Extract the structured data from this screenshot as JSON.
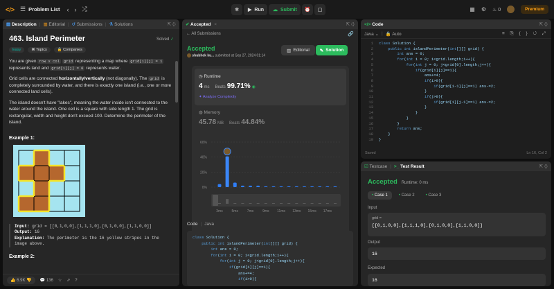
{
  "topbar": {
    "problem_list": "Problem List",
    "run": "Run",
    "submit": "Submit",
    "streak": "0",
    "premium": "Premium"
  },
  "desc_panel": {
    "tabs": [
      "Description",
      "Editorial",
      "Submissions",
      "Solutions"
    ],
    "title": "463. Island Perimeter",
    "solved": "Solved",
    "difficulty": "Easy",
    "topics": "Topics",
    "companies": "Companies",
    "p1_a": "You are given ",
    "p1_code1": "row x col",
    "p1_b": " ",
    "p1_code2": "grid",
    "p1_c": " representing a map where ",
    "p1_code3": "grid[i][j] = 1",
    "p1_d": " represents land and ",
    "p1_code4": "grid[i][j] = 0",
    "p1_e": " represents water.",
    "p2_a": "Grid cells are connected ",
    "p2_b": "horizontally/vertically",
    "p2_c": " (not diagonally). The ",
    "p2_code": "grid",
    "p2_d": " is completely surrounded by water, and there is exactly one island (i.e., one or more connected land cells).",
    "p3": "The island doesn't have \"lakes\", meaning the water inside isn't connected to the water around the island. One cell is a square with side length 1. The grid is rectangular, width and height don't exceed 100. Determine the perimeter of the island.",
    "example1": "Example 1:",
    "input_label": "Input:",
    "input_val": " grid = [[0,1,0,0],[1,1,1,0],[0,1,0,0],[1,1,0,0]]",
    "output_label": "Output:",
    "output_val": " 16",
    "expl_label": "Explanation:",
    "expl_val": " The perimeter is the 16 yellow stripes in the image above.",
    "example2": "Example 2:",
    "likes": "6.9K",
    "comments": "136",
    "grid": [
      [
        0,
        1,
        0,
        0
      ],
      [
        1,
        1,
        1,
        0
      ],
      [
        0,
        1,
        0,
        0
      ],
      [
        1,
        1,
        0,
        0
      ]
    ]
  },
  "sub_panel": {
    "tab": "Accepted",
    "all_subs": "All Submissions",
    "status": "Accepted",
    "user": "shubhek ku...",
    "submitted": "submitted at Sep 27, 2024 01:14",
    "editorial": "Editorial",
    "solution": "Solution",
    "runtime_label": "Runtime",
    "runtime_val": "4",
    "runtime_unit": "ms",
    "beats_label": "Beats",
    "beats_val": "99.71%",
    "analyze": "Analyze Complexity",
    "memory_label": "Memory",
    "memory_val": "45.78",
    "memory_unit": "MB",
    "mem_beats_label": "Beats",
    "mem_beats_val": "44.84%",
    "code_label": "Code",
    "lang": "Java"
  },
  "chart_data": {
    "type": "bar",
    "title": "",
    "ylabel": "",
    "yticks": [
      "60%",
      "40%",
      "20%",
      "0%"
    ],
    "ylim": [
      0,
      60
    ],
    "xticks": [
      "3ms",
      "5ms",
      "7ms",
      "9ms",
      "11ms",
      "13ms",
      "15ms",
      "17ms"
    ],
    "bars": [
      {
        "x": 3,
        "y": 4
      },
      {
        "x": 4,
        "y": 41
      },
      {
        "x": 5,
        "y": 6
      },
      {
        "x": 6,
        "y": 2
      },
      {
        "x": 7,
        "y": 2
      },
      {
        "x": 8,
        "y": 2
      },
      {
        "x": 9,
        "y": 1
      },
      {
        "x": 10,
        "y": 1
      },
      {
        "x": 11,
        "y": 1
      },
      {
        "x": 12,
        "y": 1
      },
      {
        "x": 13,
        "y": 1
      },
      {
        "x": 14,
        "y": 1
      },
      {
        "x": 15,
        "y": 1
      },
      {
        "x": 16,
        "y": 1
      },
      {
        "x": 17,
        "y": 1
      },
      {
        "x": 18,
        "y": 1
      }
    ],
    "highlight_x": 4,
    "mini_labels": [
      "3ms",
      "5ms",
      "7ms",
      "9ms",
      "11ms",
      "13ms",
      "15ms",
      "17ms"
    ]
  },
  "code_panel": {
    "title": "Code",
    "lang": "Java",
    "auto": "Auto",
    "saved": "Saved",
    "cursor": "Ln 16, Col 2",
    "lines": [
      "class Solution {",
      "    public int islandPerimeter(int[][] grid) {",
      "        int ans = 0;",
      "        for(int i = 0; i<grid.length;i++){",
      "            for(int j = 0; j<grid[0].length;j++){",
      "                if(grid[i][j]==1){",
      "                    ans+=4;",
      "                    if(i>0){",
      "                        if(grid[i-1][j]==1) ans-=2;",
      "                    }",
      "                    if(j>0){",
      "                        if(grid[i][j-1]==1) ans-=2;",
      "                    }",
      "                }",
      "            }",
      "        }",
      "        return ans;",
      "    }",
      "}"
    ]
  },
  "sub_code_lines": [
    "class Solution {",
    "    public int islandPerimeter(int[][] grid) {",
    "        int ans = 0;",
    "        for(int i = 0; i<grid.length;i++){",
    "            for(int j = 0; j<grid[0].length;j++){",
    "                if(grid[i][j]==1){",
    "                    ans+=4;",
    "                    if(i>0){"
  ],
  "test_panel": {
    "tab_testcase": "Testcase",
    "tab_result": "Test Result",
    "status": "Accepted",
    "runtime": "Runtime: 0 ms",
    "cases": [
      "Case 1",
      "Case 2",
      "Case 3"
    ],
    "input_label": "Input",
    "grid_label": "grid =",
    "grid_val": "[[0,1,0,0],[1,1,1,0],[0,1,0,0],[1,1,0,0]]",
    "output_label": "Output",
    "output_val": "16",
    "expected_label": "Expected",
    "expected_val": "16"
  },
  "colors": {
    "accent_green": "#2cbb5d",
    "bar_blue": "#2f7df6",
    "premium": "#ffa116"
  }
}
